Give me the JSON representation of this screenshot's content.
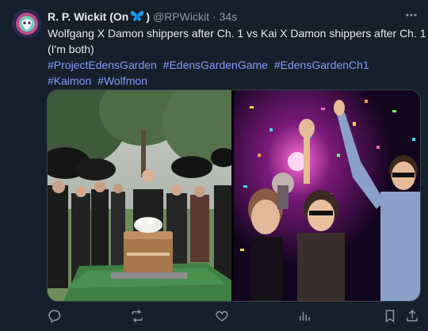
{
  "post": {
    "display_name": "R. P. Wickit (On",
    "badge_icon": "butterfly-icon",
    "name_close": ")",
    "handle": "@RPWickit",
    "separator": "·",
    "time": "34s",
    "text_lines": [
      "Wolfgang X Damon shippers after Ch. 1 vs Kai X Damon shippers after Ch. 1",
      "(I'm both)"
    ],
    "hashtags": [
      "#ProjectEdensGarden",
      "#EdensGardenGame",
      "#EdensGardenCh1",
      "#Kaimon",
      "#Wolfmon"
    ]
  },
  "media": {
    "left_image": "funeral-photo",
    "right_image": "party-photo"
  },
  "actions": [
    "reply-icon",
    "retweet-icon",
    "like-icon",
    "views-icon",
    "bookmark-icon",
    "share-icon"
  ],
  "colors": {
    "background": "#15202b",
    "text": "#e7e9ea",
    "muted": "#8b98a5",
    "hashtag": "#8b97ff",
    "badge": "#1d9bf0"
  }
}
